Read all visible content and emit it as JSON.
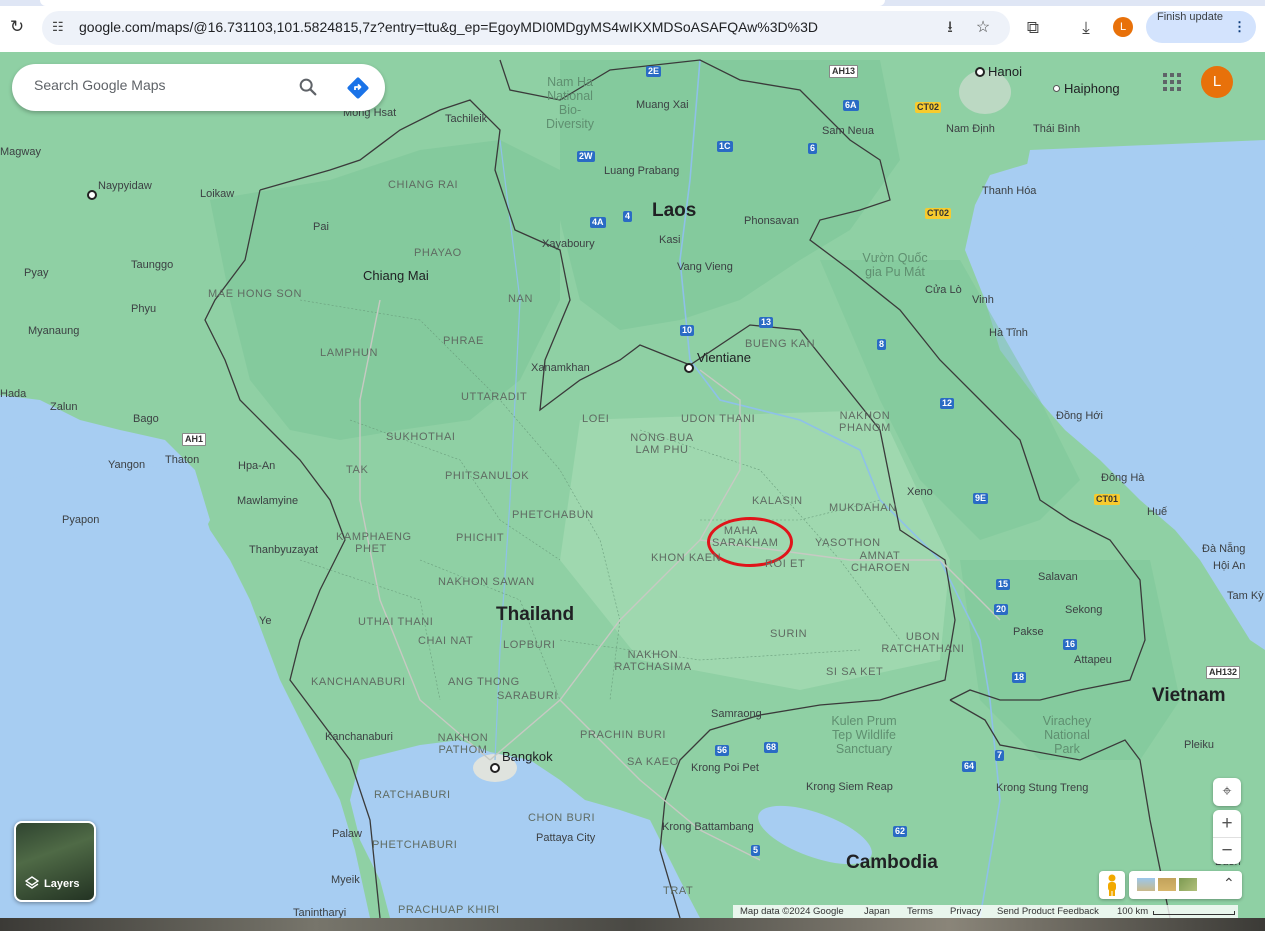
{
  "browser": {
    "url": "google.com/maps/@16.731103,101.5824815,7z?entry=ttu&g_ep=EgoyMDI0MDgyMS4wIKXMDSoASAFQAw%3D%3D",
    "profile_initial": "L",
    "finish_update_label": "Finish update"
  },
  "search": {
    "placeholder": "Search Google Maps"
  },
  "account": {
    "initial": "L"
  },
  "map": {
    "countries": [
      "Laos",
      "Thailand",
      "Vietnam",
      "Cambodia"
    ],
    "cities": [
      {
        "name": "Hanoi"
      },
      {
        "name": "Haiphong"
      },
      {
        "name": "Nam Định"
      },
      {
        "name": "Thái Bình"
      },
      {
        "name": "Thanh Hóa"
      },
      {
        "name": "Vinh"
      },
      {
        "name": "Cửa Lò"
      },
      {
        "name": "Hà Tĩnh"
      },
      {
        "name": "Đồng Hới"
      },
      {
        "name": "Đông Hà"
      },
      {
        "name": "Huế"
      },
      {
        "name": "Đà Nẵng"
      },
      {
        "name": "Hội An"
      },
      {
        "name": "Tam Kỳ"
      },
      {
        "name": "Vientiane"
      },
      {
        "name": "Bangkok"
      },
      {
        "name": "Chiang Mai"
      },
      {
        "name": "Naypyidaw"
      },
      {
        "name": "Yangon"
      },
      {
        "name": "Mawlamyine"
      },
      {
        "name": "Luang Prabang"
      },
      {
        "name": "Phonsavan"
      },
      {
        "name": "Kasi"
      },
      {
        "name": "Vang Vieng"
      },
      {
        "name": "Xayaboury"
      },
      {
        "name": "Xanamkhan"
      },
      {
        "name": "Muang Xai"
      },
      {
        "name": "Pakse"
      },
      {
        "name": "Salavan"
      },
      {
        "name": "Sekong"
      },
      {
        "name": "Attapeu"
      },
      {
        "name": "Xeno"
      },
      {
        "name": "Sam Neua"
      },
      {
        "name": "Pattaya City"
      },
      {
        "name": "Krong Battambang"
      },
      {
        "name": "Krong Siem Reap"
      },
      {
        "name": "Krong Poi Pet"
      },
      {
        "name": "Samraong"
      },
      {
        "name": "Krong Stung Treng"
      },
      {
        "name": "Pleiku"
      },
      {
        "name": "Buon"
      },
      {
        "name": "Pai"
      },
      {
        "name": "Loikaw"
      },
      {
        "name": "Taunggo"
      },
      {
        "name": "Pyay"
      },
      {
        "name": "Phyu"
      },
      {
        "name": "Myanaung"
      },
      {
        "name": "Hada"
      },
      {
        "name": "Zalun"
      },
      {
        "name": "Bago"
      },
      {
        "name": "Thaton"
      },
      {
        "name": "Hpa-An"
      },
      {
        "name": "Pyapon"
      },
      {
        "name": "Thanbyuzayat"
      },
      {
        "name": "Ye"
      },
      {
        "name": "Kanchanaburi"
      },
      {
        "name": "Palaw"
      },
      {
        "name": "Myeik"
      },
      {
        "name": "Tanintharyi"
      },
      {
        "name": "Magway"
      },
      {
        "name": "Mong Hsat"
      },
      {
        "name": "Tachileik"
      },
      {
        "name": "Nam Ha National Bio-Diversity"
      }
    ],
    "provinces": [
      "CHIANG RAI",
      "PHAYAO",
      "NAN",
      "MAE HONG SON",
      "LAMPHUN",
      "PHRAE",
      "UTTARADIT",
      "SUKHOTHAI",
      "TAK",
      "PHITSANULOK",
      "PHETCHABUN",
      "KAMPHAENG PHET",
      "PHICHIT",
      "NAKHON SAWAN",
      "UTHAI THANI",
      "CHAI NAT",
      "LOPBURI",
      "ANG THONG",
      "SARABURI",
      "KANCHANABURI",
      "NAKHON PATHOM",
      "RATCHABURI",
      "PHETCHABURI",
      "PRACHUAP KHIRI",
      "CHON BURI",
      "PRACHIN BURI",
      "SA KAEO",
      "TRAT",
      "NAKHON RATCHASIMA",
      "SURIN",
      "SI SA KET",
      "UBON RATCHATHANI",
      "YASOTHON",
      "AMNAT CHAROEN",
      "MUKDAHAN",
      "KALASIN",
      "KHON KAEN",
      "ROI ET",
      "LOEI",
      "UDON THANI",
      "NONG BUA LAM PHU",
      "NAKHON PHANOM",
      "BUENG KAN"
    ],
    "highlighted_province": "MAHA SARAKHAM",
    "protected_areas": [
      "Vườn Quốc gia Pu Mát",
      "Kulen Prum Tep Wildlife Sanctuary",
      "Virachey National Park"
    ],
    "route_shields": [
      "2E",
      "6A",
      "1C",
      "6",
      "2W",
      "4",
      "4A",
      "10",
      "13",
      "8",
      "12",
      "9E",
      "15",
      "16",
      "20",
      "18",
      "56",
      "68",
      "64",
      "62",
      "5",
      "7",
      "AH13",
      "AH1",
      "AH132",
      "CT02",
      "CT01"
    ]
  },
  "controls": {
    "layers_label": "Layers",
    "zoom_in": "+",
    "zoom_out": "−"
  },
  "footer": {
    "map_data": "Map data ©2024 Google",
    "country": "Japan",
    "terms": "Terms",
    "privacy": "Privacy",
    "feedback": "Send Product Feedback",
    "scale": "100 km"
  },
  "colors": {
    "water": "#a7cdf2",
    "land": "#8fd0a4",
    "marker": "#e0141a",
    "accent_blue": "#1a73e8",
    "avatar": "#e8710a"
  }
}
